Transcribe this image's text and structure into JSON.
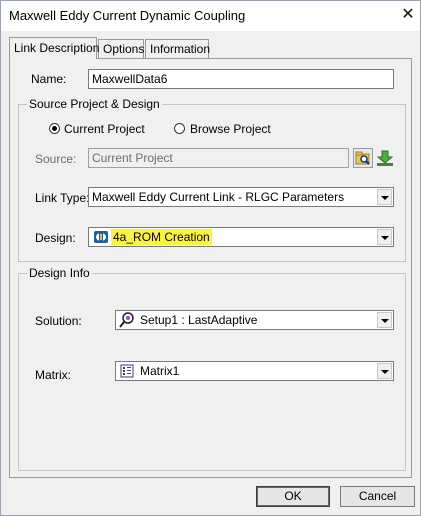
{
  "window": {
    "title": "Maxwell Eddy Current Dynamic Coupling",
    "close_glyph": "✕"
  },
  "tabs": [
    {
      "label": "Link Description",
      "active": true
    },
    {
      "label": "Options",
      "active": false
    },
    {
      "label": "Information",
      "active": false
    }
  ],
  "name": {
    "label": "Name:",
    "value": "MaxwellData6"
  },
  "source_group": {
    "title": "Source Project & Design",
    "radio_current": "Current Project",
    "radio_browse": "Browse Project",
    "selected": "current",
    "source_label": "Source:",
    "source_value": "Current Project",
    "browse_icon": "folder-search-icon",
    "load_icon": "download-arrow-icon",
    "link_type_label": "Link Type:",
    "link_type_value": "Maxwell Eddy Current Link - RLGC Parameters",
    "design_label": "Design:",
    "design_value": "4a_ROM Creation",
    "design_icon": "maxwell-design-icon",
    "highlight_color": "#fbf43a"
  },
  "design_info_group": {
    "title": "Design Info",
    "solution_label": "Solution:",
    "solution_value": "Setup1 : LastAdaptive",
    "solution_icon": "solution-setup-icon",
    "matrix_label": "Matrix:",
    "matrix_value": "Matrix1",
    "matrix_icon": "matrix-icon"
  },
  "buttons": {
    "ok": "OK",
    "cancel": "Cancel"
  }
}
